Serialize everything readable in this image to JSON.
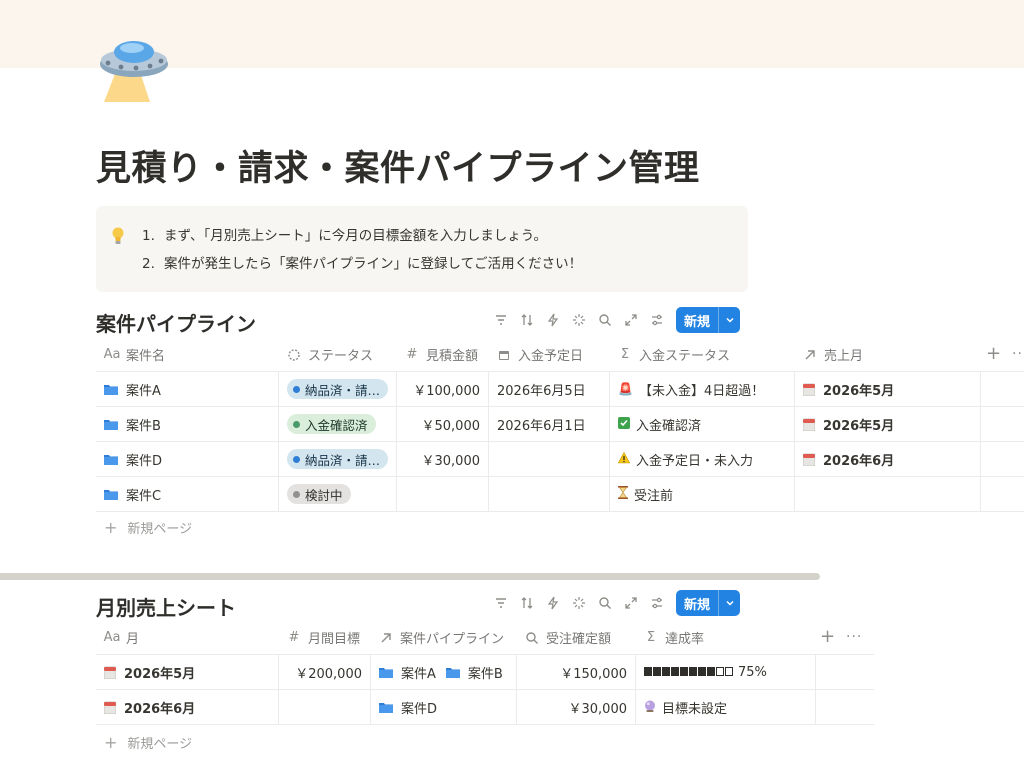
{
  "page": {
    "title": "見積り・請求・案件パイプライン管理",
    "icon": "ufo-icon"
  },
  "callout": {
    "icon": "lightbulb-icon",
    "items": [
      {
        "num": "1.",
        "text": "まず、「月別売上シート」に今月の目標金額を入力しましょう。"
      },
      {
        "num": "2.",
        "text": "案件が発生したら「案件パイプライン」に登録してご活用ください！"
      }
    ]
  },
  "pipeline": {
    "title": "案件パイプライン",
    "new_label": "新規",
    "new_page_label": "新規ページ",
    "columns": [
      {
        "label": "案件名",
        "icon": "Aa"
      },
      {
        "label": "ステータス",
        "icon": "status-icon"
      },
      {
        "label": "見積金額",
        "icon": "#"
      },
      {
        "label": "入金予定日",
        "icon": "calendar-icon"
      },
      {
        "label": "入金ステータス",
        "icon": "Σ"
      },
      {
        "label": "売上月",
        "icon": "relation-arrow-icon"
      }
    ],
    "rows": [
      {
        "name": "案件A",
        "status": "納品済・請…",
        "status_color": "blue",
        "amount": "￥100,000",
        "due": "2026年6月5日",
        "pay_emoji": "🚨",
        "pay_status": "【未入金】4日超過！",
        "month": "2026年5月"
      },
      {
        "name": "案件B",
        "status": "入金確認済",
        "status_color": "green",
        "amount": "￥50,000",
        "due": "2026年6月1日",
        "pay_emoji": "✅",
        "pay_status": "入金確認済",
        "month": "2026年5月"
      },
      {
        "name": "案件D",
        "status": "納品済・請…",
        "status_color": "blue",
        "amount": "￥30,000",
        "due": "",
        "pay_emoji": "⚠",
        "pay_status": "入金予定日・未入力",
        "month": "2026年6月"
      },
      {
        "name": "案件C",
        "status": "検討中",
        "status_color": "gray",
        "amount": "",
        "due": "",
        "pay_emoji": "⏳",
        "pay_status": "受注前",
        "month": ""
      }
    ]
  },
  "monthly": {
    "title": "月別売上シート",
    "new_label": "新規",
    "new_page_label": "新規ページ",
    "columns": [
      {
        "label": "月",
        "icon": "Aa"
      },
      {
        "label": "月間目標",
        "icon": "#"
      },
      {
        "label": "案件パイプライン",
        "icon": "relation-arrow-icon"
      },
      {
        "label": "受注確定額",
        "icon": "search-icon"
      },
      {
        "label": "達成率",
        "icon": "Σ"
      }
    ],
    "rows": [
      {
        "month": "2026年5月",
        "target": "￥200,000",
        "projects": [
          "案件A",
          "案件B"
        ],
        "confirmed": "￥150,000",
        "rate_emoji": "",
        "rate": "75%",
        "rate_fraction": 0.75
      },
      {
        "month": "2026年6月",
        "target": "",
        "projects": [
          "案件D"
        ],
        "confirmed": "￥30,000",
        "rate_emoji": "🔮",
        "rate": "目標未設定",
        "rate_fraction": null
      }
    ]
  },
  "colors": {
    "accent": "#2383e2",
    "cover": "#fbf5ee",
    "callout_bg": "#f7f6f3"
  }
}
